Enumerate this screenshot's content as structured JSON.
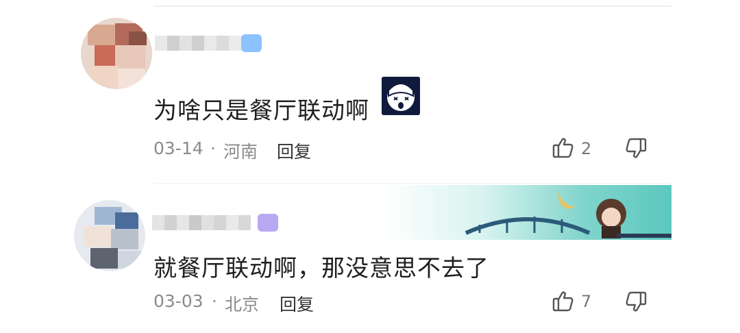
{
  "comments": [
    {
      "text": "为啥只是餐厅联动啊",
      "date": "03-14",
      "separator": "·",
      "location": "河南",
      "reply_label": "回复",
      "likes": "2",
      "has_sticker": true
    },
    {
      "text": "就餐厅联动啊，那没意思不去了",
      "date": "03-03",
      "separator": "·",
      "location": "北京",
      "reply_label": "回复",
      "likes": "7",
      "has_sticker": false
    }
  ],
  "colors": {
    "text": "#1f1f1f",
    "meta": "#8a8a8a",
    "vip_badge_1": "#7fb9ff",
    "vip_badge_2": "#b8a6f5",
    "banner_teal": "#5cc8bf"
  },
  "icons": {
    "like": "thumbs-up-icon",
    "dislike": "thumbs-down-icon"
  }
}
